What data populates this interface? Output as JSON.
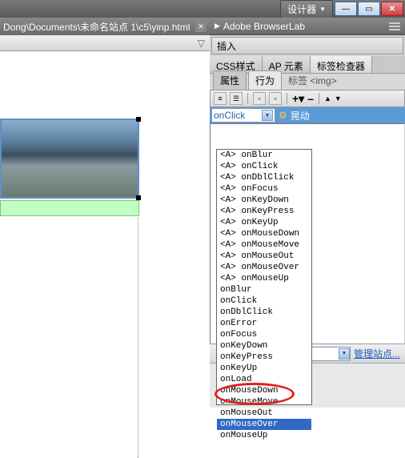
{
  "topbar": {
    "designer_label": "设计器"
  },
  "document": {
    "tab_path": "Dong\\Documents\\未命名站点 1\\c5\\yinp.html"
  },
  "panels": {
    "browserlab_title": "Adobe BrowserLab",
    "insert_label": "插入",
    "tabs": {
      "css": "CSS样式",
      "ap": "AP 元素",
      "inspector": "标签检查器"
    },
    "sub_tabs": {
      "attrs": "属性",
      "behaviors": "行为"
    },
    "tag_label": "标签 <img>"
  },
  "behaviors": {
    "selected_event": "onClick",
    "action_label": "晃动",
    "events": [
      "<A> onBlur",
      "<A> onClick",
      "<A> onDblClick",
      "<A> onFocus",
      "<A> onKeyDown",
      "<A> onKeyPress",
      "<A> onKeyUp",
      "<A> onMouseDown",
      "<A> onMouseMove",
      "<A> onMouseOut",
      "<A> onMouseOver",
      "<A> onMouseUp",
      "onBlur",
      "onClick",
      "onDblClick",
      "onError",
      "onFocus",
      "onKeyDown",
      "onKeyPress",
      "onKeyUp",
      "onLoad",
      "onMouseDown",
      "onMouseMove",
      "onMouseOut",
      "onMouseOver",
      "onMouseUp"
    ],
    "selected_index": 24
  },
  "files": {
    "manage_label": "管理站点..."
  }
}
